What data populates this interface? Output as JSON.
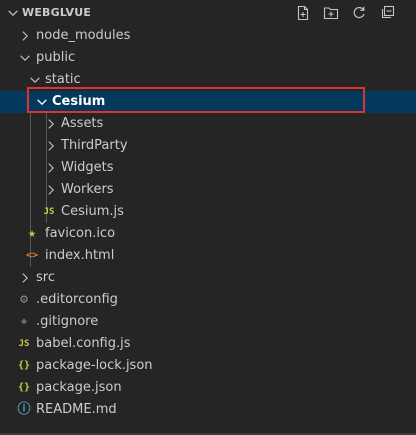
{
  "header": {
    "title": "WEBGLVUE",
    "actions": [
      "new-file",
      "new-folder",
      "refresh",
      "collapse-all"
    ]
  },
  "tree": {
    "items": [
      {
        "label": "node_modules",
        "type": "folder",
        "expanded": false,
        "depth": 1
      },
      {
        "label": "public",
        "type": "folder",
        "expanded": true,
        "depth": 1
      },
      {
        "label": "static",
        "type": "folder",
        "expanded": true,
        "depth": 2
      },
      {
        "label": "Cesium",
        "type": "folder",
        "expanded": true,
        "depth": 3,
        "selected": true
      },
      {
        "label": "Assets",
        "type": "folder",
        "expanded": false,
        "depth": 4
      },
      {
        "label": "ThirdParty",
        "type": "folder",
        "expanded": false,
        "depth": 4
      },
      {
        "label": "Widgets",
        "type": "folder",
        "expanded": false,
        "depth": 4
      },
      {
        "label": "Workers",
        "type": "folder",
        "expanded": false,
        "depth": 4
      },
      {
        "label": "Cesium.js",
        "type": "file",
        "icon": "JS",
        "depth": 4
      },
      {
        "label": "favicon.ico",
        "type": "file",
        "icon": "★",
        "depth": 2
      },
      {
        "label": "index.html",
        "type": "file",
        "icon": "<>",
        "depth": 2
      },
      {
        "label": "src",
        "type": "folder",
        "expanded": false,
        "depth": 1
      },
      {
        "label": ".editorconfig",
        "type": "file",
        "icon": "⚙",
        "depth": 1
      },
      {
        "label": ".gitignore",
        "type": "file",
        "icon": "◆",
        "depth": 1
      },
      {
        "label": "babel.config.js",
        "type": "file",
        "icon": "JS",
        "depth": 1
      },
      {
        "label": "package-lock.json",
        "type": "file",
        "icon": "{}",
        "depth": 1
      },
      {
        "label": "package.json",
        "type": "file",
        "icon": "{}",
        "depth": 1
      },
      {
        "label": "README.md",
        "type": "file",
        "icon": "ⓘ",
        "depth": 1
      }
    ]
  },
  "colors": {
    "background": "#252526",
    "selected": "#04395e",
    "highlight": "#e0302f",
    "js": "#cbcb41",
    "json": "#cbcb41",
    "html": "#e37933",
    "favicon": "#cbcb41",
    "info": "#519aba",
    "gear": "#8b8b8b"
  }
}
